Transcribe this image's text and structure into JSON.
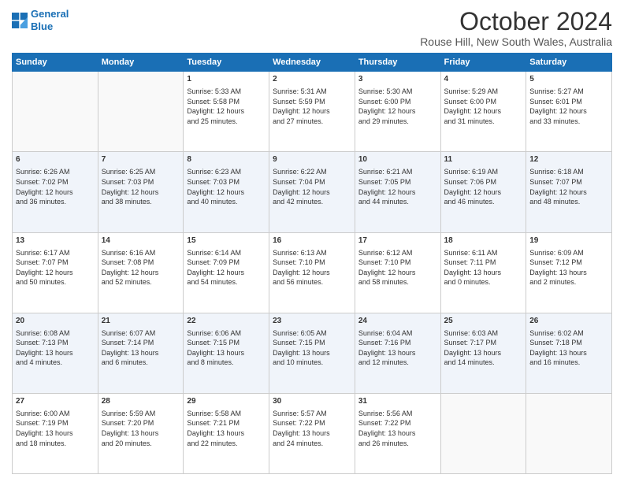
{
  "logo": {
    "line1": "General",
    "line2": "Blue"
  },
  "title": "October 2024",
  "subtitle": "Rouse Hill, New South Wales, Australia",
  "weekdays": [
    "Sunday",
    "Monday",
    "Tuesday",
    "Wednesday",
    "Thursday",
    "Friday",
    "Saturday"
  ],
  "weeks": [
    [
      {
        "day": "",
        "info": ""
      },
      {
        "day": "",
        "info": ""
      },
      {
        "day": "1",
        "info": "Sunrise: 5:33 AM\nSunset: 5:58 PM\nDaylight: 12 hours\nand 25 minutes."
      },
      {
        "day": "2",
        "info": "Sunrise: 5:31 AM\nSunset: 5:59 PM\nDaylight: 12 hours\nand 27 minutes."
      },
      {
        "day": "3",
        "info": "Sunrise: 5:30 AM\nSunset: 6:00 PM\nDaylight: 12 hours\nand 29 minutes."
      },
      {
        "day": "4",
        "info": "Sunrise: 5:29 AM\nSunset: 6:00 PM\nDaylight: 12 hours\nand 31 minutes."
      },
      {
        "day": "5",
        "info": "Sunrise: 5:27 AM\nSunset: 6:01 PM\nDaylight: 12 hours\nand 33 minutes."
      }
    ],
    [
      {
        "day": "6",
        "info": "Sunrise: 6:26 AM\nSunset: 7:02 PM\nDaylight: 12 hours\nand 36 minutes."
      },
      {
        "day": "7",
        "info": "Sunrise: 6:25 AM\nSunset: 7:03 PM\nDaylight: 12 hours\nand 38 minutes."
      },
      {
        "day": "8",
        "info": "Sunrise: 6:23 AM\nSunset: 7:03 PM\nDaylight: 12 hours\nand 40 minutes."
      },
      {
        "day": "9",
        "info": "Sunrise: 6:22 AM\nSunset: 7:04 PM\nDaylight: 12 hours\nand 42 minutes."
      },
      {
        "day": "10",
        "info": "Sunrise: 6:21 AM\nSunset: 7:05 PM\nDaylight: 12 hours\nand 44 minutes."
      },
      {
        "day": "11",
        "info": "Sunrise: 6:19 AM\nSunset: 7:06 PM\nDaylight: 12 hours\nand 46 minutes."
      },
      {
        "day": "12",
        "info": "Sunrise: 6:18 AM\nSunset: 7:07 PM\nDaylight: 12 hours\nand 48 minutes."
      }
    ],
    [
      {
        "day": "13",
        "info": "Sunrise: 6:17 AM\nSunset: 7:07 PM\nDaylight: 12 hours\nand 50 minutes."
      },
      {
        "day": "14",
        "info": "Sunrise: 6:16 AM\nSunset: 7:08 PM\nDaylight: 12 hours\nand 52 minutes."
      },
      {
        "day": "15",
        "info": "Sunrise: 6:14 AM\nSunset: 7:09 PM\nDaylight: 12 hours\nand 54 minutes."
      },
      {
        "day": "16",
        "info": "Sunrise: 6:13 AM\nSunset: 7:10 PM\nDaylight: 12 hours\nand 56 minutes."
      },
      {
        "day": "17",
        "info": "Sunrise: 6:12 AM\nSunset: 7:10 PM\nDaylight: 12 hours\nand 58 minutes."
      },
      {
        "day": "18",
        "info": "Sunrise: 6:11 AM\nSunset: 7:11 PM\nDaylight: 13 hours\nand 0 minutes."
      },
      {
        "day": "19",
        "info": "Sunrise: 6:09 AM\nSunset: 7:12 PM\nDaylight: 13 hours\nand 2 minutes."
      }
    ],
    [
      {
        "day": "20",
        "info": "Sunrise: 6:08 AM\nSunset: 7:13 PM\nDaylight: 13 hours\nand 4 minutes."
      },
      {
        "day": "21",
        "info": "Sunrise: 6:07 AM\nSunset: 7:14 PM\nDaylight: 13 hours\nand 6 minutes."
      },
      {
        "day": "22",
        "info": "Sunrise: 6:06 AM\nSunset: 7:15 PM\nDaylight: 13 hours\nand 8 minutes."
      },
      {
        "day": "23",
        "info": "Sunrise: 6:05 AM\nSunset: 7:15 PM\nDaylight: 13 hours\nand 10 minutes."
      },
      {
        "day": "24",
        "info": "Sunrise: 6:04 AM\nSunset: 7:16 PM\nDaylight: 13 hours\nand 12 minutes."
      },
      {
        "day": "25",
        "info": "Sunrise: 6:03 AM\nSunset: 7:17 PM\nDaylight: 13 hours\nand 14 minutes."
      },
      {
        "day": "26",
        "info": "Sunrise: 6:02 AM\nSunset: 7:18 PM\nDaylight: 13 hours\nand 16 minutes."
      }
    ],
    [
      {
        "day": "27",
        "info": "Sunrise: 6:00 AM\nSunset: 7:19 PM\nDaylight: 13 hours\nand 18 minutes."
      },
      {
        "day": "28",
        "info": "Sunrise: 5:59 AM\nSunset: 7:20 PM\nDaylight: 13 hours\nand 20 minutes."
      },
      {
        "day": "29",
        "info": "Sunrise: 5:58 AM\nSunset: 7:21 PM\nDaylight: 13 hours\nand 22 minutes."
      },
      {
        "day": "30",
        "info": "Sunrise: 5:57 AM\nSunset: 7:22 PM\nDaylight: 13 hours\nand 24 minutes."
      },
      {
        "day": "31",
        "info": "Sunrise: 5:56 AM\nSunset: 7:22 PM\nDaylight: 13 hours\nand 26 minutes."
      },
      {
        "day": "",
        "info": ""
      },
      {
        "day": "",
        "info": ""
      }
    ]
  ]
}
